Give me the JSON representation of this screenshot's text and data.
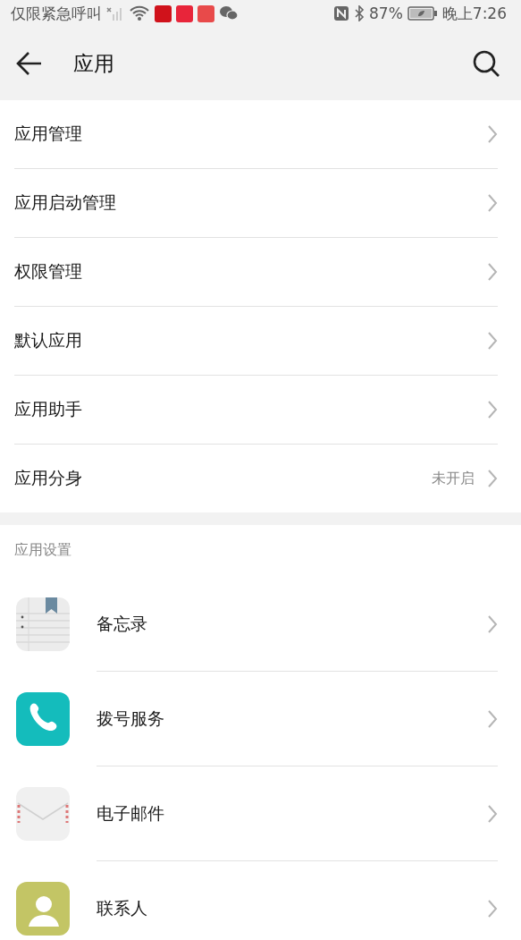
{
  "status_bar": {
    "carrier": "仅限紧急呼叫",
    "battery": "87%",
    "time": "晚上7:26",
    "notifications": [
      {
        "color": "#d0121b"
      },
      {
        "color": "#e8253a"
      },
      {
        "color": "#e84a4a"
      }
    ]
  },
  "header": {
    "title": "应用"
  },
  "menu": [
    {
      "label": "应用管理"
    },
    {
      "label": "应用启动管理"
    },
    {
      "label": "权限管理"
    },
    {
      "label": "默认应用"
    },
    {
      "label": "应用助手"
    },
    {
      "label": "应用分身",
      "value": "未开启"
    }
  ],
  "section": {
    "title": "应用设置"
  },
  "apps": [
    {
      "name": "备忘录",
      "kind": "memo"
    },
    {
      "name": "拨号服务",
      "kind": "phone"
    },
    {
      "name": "电子邮件",
      "kind": "mail"
    },
    {
      "name": "联系人",
      "kind": "contacts"
    }
  ]
}
